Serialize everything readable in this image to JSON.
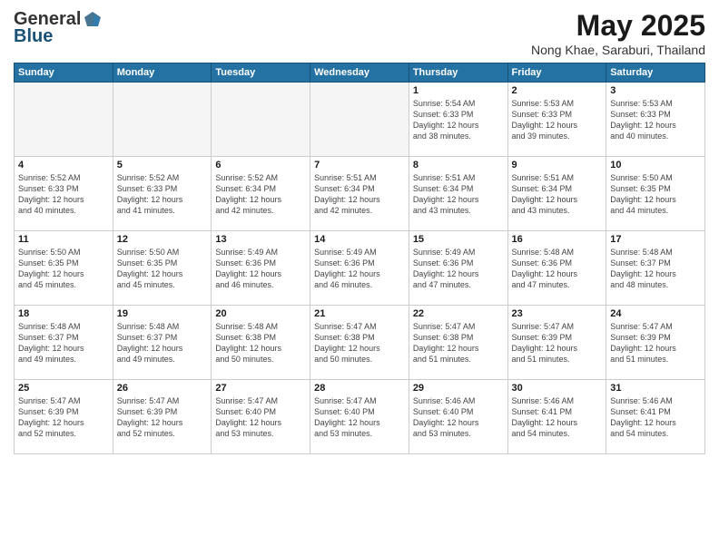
{
  "header": {
    "logo_general": "General",
    "logo_blue": "Blue",
    "title": "May 2025",
    "subtitle": "Nong Khae, Saraburi, Thailand"
  },
  "days_of_week": [
    "Sunday",
    "Monday",
    "Tuesday",
    "Wednesday",
    "Thursday",
    "Friday",
    "Saturday"
  ],
  "weeks": [
    [
      {
        "day": "",
        "info": ""
      },
      {
        "day": "",
        "info": ""
      },
      {
        "day": "",
        "info": ""
      },
      {
        "day": "",
        "info": ""
      },
      {
        "day": "1",
        "info": "Sunrise: 5:54 AM\nSunset: 6:33 PM\nDaylight: 12 hours\nand 38 minutes."
      },
      {
        "day": "2",
        "info": "Sunrise: 5:53 AM\nSunset: 6:33 PM\nDaylight: 12 hours\nand 39 minutes."
      },
      {
        "day": "3",
        "info": "Sunrise: 5:53 AM\nSunset: 6:33 PM\nDaylight: 12 hours\nand 40 minutes."
      }
    ],
    [
      {
        "day": "4",
        "info": "Sunrise: 5:52 AM\nSunset: 6:33 PM\nDaylight: 12 hours\nand 40 minutes."
      },
      {
        "day": "5",
        "info": "Sunrise: 5:52 AM\nSunset: 6:33 PM\nDaylight: 12 hours\nand 41 minutes."
      },
      {
        "day": "6",
        "info": "Sunrise: 5:52 AM\nSunset: 6:34 PM\nDaylight: 12 hours\nand 42 minutes."
      },
      {
        "day": "7",
        "info": "Sunrise: 5:51 AM\nSunset: 6:34 PM\nDaylight: 12 hours\nand 42 minutes."
      },
      {
        "day": "8",
        "info": "Sunrise: 5:51 AM\nSunset: 6:34 PM\nDaylight: 12 hours\nand 43 minutes."
      },
      {
        "day": "9",
        "info": "Sunrise: 5:51 AM\nSunset: 6:34 PM\nDaylight: 12 hours\nand 43 minutes."
      },
      {
        "day": "10",
        "info": "Sunrise: 5:50 AM\nSunset: 6:35 PM\nDaylight: 12 hours\nand 44 minutes."
      }
    ],
    [
      {
        "day": "11",
        "info": "Sunrise: 5:50 AM\nSunset: 6:35 PM\nDaylight: 12 hours\nand 45 minutes."
      },
      {
        "day": "12",
        "info": "Sunrise: 5:50 AM\nSunset: 6:35 PM\nDaylight: 12 hours\nand 45 minutes."
      },
      {
        "day": "13",
        "info": "Sunrise: 5:49 AM\nSunset: 6:36 PM\nDaylight: 12 hours\nand 46 minutes."
      },
      {
        "day": "14",
        "info": "Sunrise: 5:49 AM\nSunset: 6:36 PM\nDaylight: 12 hours\nand 46 minutes."
      },
      {
        "day": "15",
        "info": "Sunrise: 5:49 AM\nSunset: 6:36 PM\nDaylight: 12 hours\nand 47 minutes."
      },
      {
        "day": "16",
        "info": "Sunrise: 5:48 AM\nSunset: 6:36 PM\nDaylight: 12 hours\nand 47 minutes."
      },
      {
        "day": "17",
        "info": "Sunrise: 5:48 AM\nSunset: 6:37 PM\nDaylight: 12 hours\nand 48 minutes."
      }
    ],
    [
      {
        "day": "18",
        "info": "Sunrise: 5:48 AM\nSunset: 6:37 PM\nDaylight: 12 hours\nand 49 minutes."
      },
      {
        "day": "19",
        "info": "Sunrise: 5:48 AM\nSunset: 6:37 PM\nDaylight: 12 hours\nand 49 minutes."
      },
      {
        "day": "20",
        "info": "Sunrise: 5:48 AM\nSunset: 6:38 PM\nDaylight: 12 hours\nand 50 minutes."
      },
      {
        "day": "21",
        "info": "Sunrise: 5:47 AM\nSunset: 6:38 PM\nDaylight: 12 hours\nand 50 minutes."
      },
      {
        "day": "22",
        "info": "Sunrise: 5:47 AM\nSunset: 6:38 PM\nDaylight: 12 hours\nand 51 minutes."
      },
      {
        "day": "23",
        "info": "Sunrise: 5:47 AM\nSunset: 6:39 PM\nDaylight: 12 hours\nand 51 minutes."
      },
      {
        "day": "24",
        "info": "Sunrise: 5:47 AM\nSunset: 6:39 PM\nDaylight: 12 hours\nand 51 minutes."
      }
    ],
    [
      {
        "day": "25",
        "info": "Sunrise: 5:47 AM\nSunset: 6:39 PM\nDaylight: 12 hours\nand 52 minutes."
      },
      {
        "day": "26",
        "info": "Sunrise: 5:47 AM\nSunset: 6:39 PM\nDaylight: 12 hours\nand 52 minutes."
      },
      {
        "day": "27",
        "info": "Sunrise: 5:47 AM\nSunset: 6:40 PM\nDaylight: 12 hours\nand 53 minutes."
      },
      {
        "day": "28",
        "info": "Sunrise: 5:47 AM\nSunset: 6:40 PM\nDaylight: 12 hours\nand 53 minutes."
      },
      {
        "day": "29",
        "info": "Sunrise: 5:46 AM\nSunset: 6:40 PM\nDaylight: 12 hours\nand 53 minutes."
      },
      {
        "day": "30",
        "info": "Sunrise: 5:46 AM\nSunset: 6:41 PM\nDaylight: 12 hours\nand 54 minutes."
      },
      {
        "day": "31",
        "info": "Sunrise: 5:46 AM\nSunset: 6:41 PM\nDaylight: 12 hours\nand 54 minutes."
      }
    ]
  ]
}
